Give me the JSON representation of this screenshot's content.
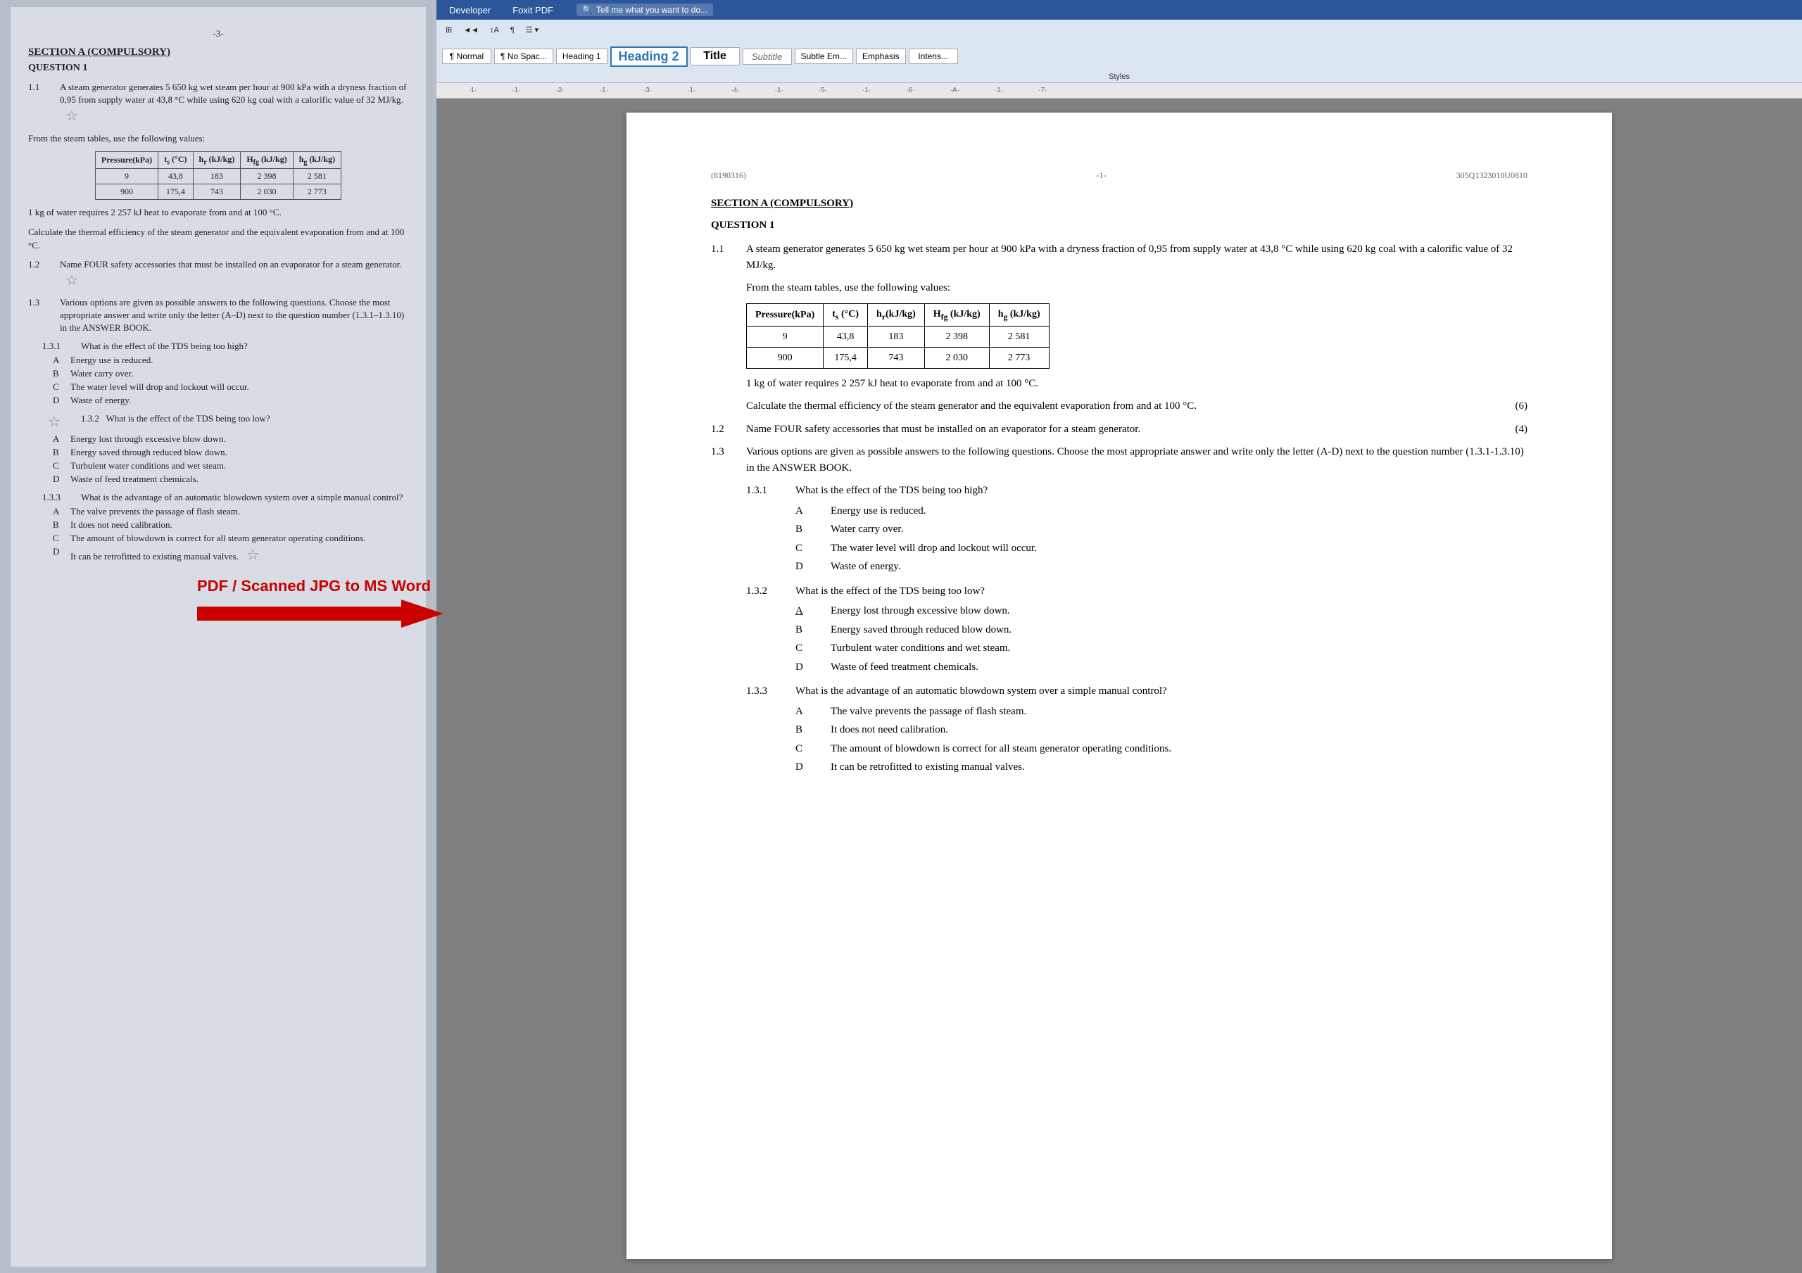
{
  "ribbon": {
    "tabs": [
      "Developer",
      "Foxit PDF"
    ],
    "search_placeholder": "Tell me what you want to do...",
    "styles_label": "Styles"
  },
  "styles": {
    "normal": "¶ Normal",
    "no_spacing": "¶ No Spac...",
    "heading1": "Heading 1",
    "heading2": "Heading 2",
    "title": "Title",
    "subtitle": "Subtitle",
    "subtle_em": "Subtle Em...",
    "emphasis": "Emphasis",
    "intense": "Intens..."
  },
  "page_header": {
    "left": "(8190316)",
    "center": "-1-",
    "right": "305Q1323010U0810"
  },
  "section_title": "SECTION A (COMPULSORY)",
  "question_title": "QUESTION 1",
  "q1_1": {
    "num": "1.1",
    "text": "A steam generator generates 5 650 kg wet steam per hour at 900 kPa with a dryness fraction of 0,95 from supply water at 43,8 °C while using 620 kg coal with a calorific value of 32 MJ/kg."
  },
  "steam_table_intro": "From the steam tables, use the following values:",
  "steam_table": {
    "headers": [
      "Pressure(kPa)",
      "ts (°C)",
      "hr(kJ/kg)",
      "Hfg (kJ/kg)",
      "hg (kJ/kg)"
    ],
    "rows": [
      [
        "9",
        "43,8",
        "183",
        "2 398",
        "2 581"
      ],
      [
        "900",
        "175,4",
        "743",
        "2 030",
        "2 773"
      ]
    ]
  },
  "q1_1_sub1": "1 kg of water requires 2 257 kJ heat to evaporate from and at 100 °C.",
  "q1_1_sub2": "Calculate the thermal efficiency of the steam generator and the equivalent evaporation from and at 100 °C.",
  "q1_1_marks": "(6)",
  "q1_2": {
    "num": "1.2",
    "text": "Name FOUR safety accessories that must be installed on an evaporator for a steam generator.",
    "marks": "(4)"
  },
  "q1_3": {
    "num": "1.3",
    "text": "Various options are given as possible answers to the following questions. Choose the most appropriate answer and write only the letter (A-D) next to the question number (1.3.1-1.3.10) in the ANSWER BOOK."
  },
  "q1_3_1": {
    "num": "1.3.1",
    "text": "What is the effect of the TDS being too high?",
    "options": [
      {
        "letter": "A",
        "text": "Energy use is reduced."
      },
      {
        "letter": "B",
        "text": "Water carry over."
      },
      {
        "letter": "C",
        "text": "The water level will drop and lockout will occur."
      },
      {
        "letter": "D",
        "text": "Waste of energy."
      }
    ]
  },
  "q1_3_2": {
    "num": "1.3.2",
    "text": "What is the effect of the TDS being too low?",
    "options": [
      {
        "letter": "A",
        "text": "Energy lost through excessive blow down."
      },
      {
        "letter": "B",
        "text": "Energy saved through reduced blow down."
      },
      {
        "letter": "C",
        "text": "Turbulent water conditions and wet steam."
      },
      {
        "letter": "D",
        "text": "Waste of feed treatment chemicals."
      }
    ]
  },
  "q1_3_3": {
    "num": "1.3.3",
    "text": "What is the advantage of an automatic blowdown system over a simple manual control?",
    "options": [
      {
        "letter": "A",
        "text": "The valve prevents the passage of flash steam."
      },
      {
        "letter": "B",
        "text": "It does not need calibration."
      },
      {
        "letter": "C",
        "text": "The amount of blowdown is correct for all steam generator operating conditions."
      },
      {
        "letter": "D",
        "text": "It can be retrofitted to existing manual valves."
      }
    ]
  },
  "arrow": {
    "label": "PDF / Scanned JPG to MS Word"
  },
  "scan": {
    "page_num": "-3-",
    "section_title": "SECTION A (COMPULSORY)",
    "question_title": "QUESTION 1"
  }
}
